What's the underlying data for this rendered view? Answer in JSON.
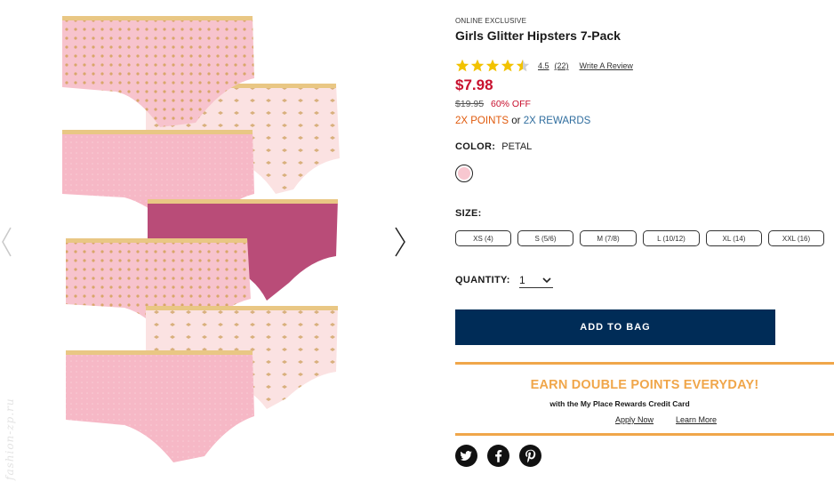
{
  "gallery": {
    "prev_icon": "chevron-left-icon",
    "next_icon": "chevron-right-icon",
    "watermark": "fashion-zp.ru"
  },
  "product": {
    "badge": "ONLINE EXCLUSIVE",
    "title": "Girls Glitter Hipsters 7-Pack",
    "rating": 4.5,
    "rating_text": "4.5",
    "review_count": "(22)",
    "write_review": "Write A Review",
    "price": "$7.98",
    "list_price": "$19.95",
    "discount": "60% OFF",
    "rewards": {
      "points": "2X POINTS",
      "or": "or",
      "rewards": "2X REWARDS"
    },
    "color_label": "COLOR:",
    "color_value": "PETAL",
    "swatch_color": "#f8c7d0",
    "size_label": "SIZE:",
    "sizes": [
      "XS (4)",
      "S (5/6)",
      "M (7/8)",
      "L (10/12)",
      "XL (14)",
      "XXL (16)"
    ],
    "quantity_label": "QUANTITY:",
    "quantity_value": "1",
    "add_to_bag": "ADD TO BAG"
  },
  "promo": {
    "title": "EARN DOUBLE POINTS EVERYDAY!",
    "subtitle": "with the My Place Rewards Credit Card",
    "apply_now": "Apply Now",
    "learn_more": "Learn More"
  },
  "social": [
    "twitter-icon",
    "facebook-icon",
    "pinterest-icon"
  ],
  "colors": {
    "price": "#c8102e",
    "button": "#002c57",
    "promo": "#f0a64a",
    "points": "#e05a0c",
    "rewards": "#2f6d9e",
    "star": "#f2c200"
  }
}
